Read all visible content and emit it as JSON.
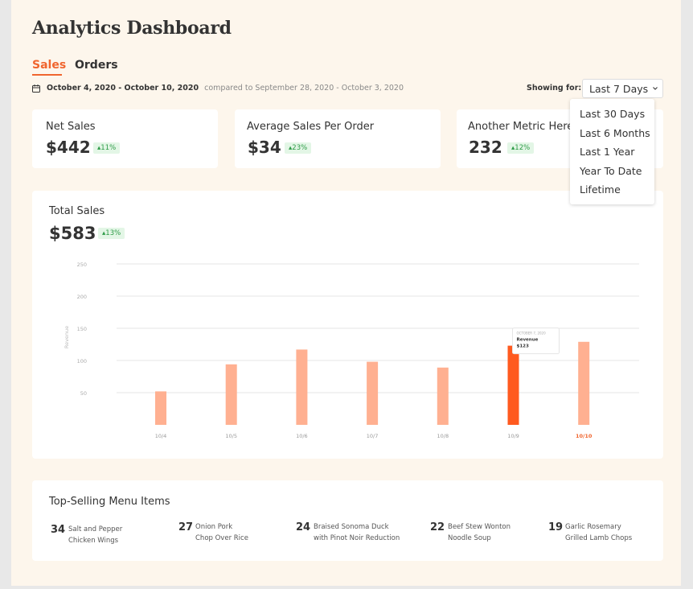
{
  "header": {
    "title": "Analytics Dashboard"
  },
  "tabs": [
    {
      "label": "Sales",
      "active": true
    },
    {
      "label": "Orders",
      "active": false
    }
  ],
  "date_range": {
    "icon": "calendar-icon",
    "range": "October 4, 2020 - October 10, 2020",
    "compare": "compared to September 28, 2020 - October 3, 2020"
  },
  "period_selector": {
    "label": "Showing for:",
    "selected": "Last 7 Days",
    "options": [
      "Last 30 Days",
      "Last 6 Months",
      "Last 1 Year",
      "Year To Date",
      "Lifetime"
    ]
  },
  "metrics": [
    {
      "label": "Net Sales",
      "value": "$442",
      "change": "11%"
    },
    {
      "label": "Average Sales Per Order",
      "value": "$34",
      "change": "23%"
    },
    {
      "label": "Another Metric Here",
      "value": "232",
      "change": "12%"
    }
  ],
  "total_sales": {
    "title": "Total Sales",
    "value": "$583",
    "change": "13%"
  },
  "chart_data": {
    "type": "bar",
    "ylabel": "Revenue",
    "ylim": [
      0,
      250
    ],
    "yticks": [
      50,
      100,
      150,
      200,
      250
    ],
    "grid": true,
    "categories": [
      "10/4",
      "10/5",
      "10/6",
      "10/7",
      "10/8",
      "10/9",
      "10/10"
    ],
    "values": [
      52,
      94,
      117,
      98,
      89,
      123,
      129
    ],
    "highlight_index": 5,
    "highlight_label_index": 6,
    "tooltip": {
      "date": "OCTOBER 7, 2020",
      "label": "Revenue",
      "value": "$123"
    },
    "colors": {
      "bar": "#ffb091",
      "bar_active": "#ff5a1f",
      "label_active": "#f0652e",
      "grid": "#e6e6e6",
      "axis_text": "#aaa"
    }
  },
  "top_selling": {
    "title": "Top-Selling Menu Items",
    "items": [
      {
        "count": "34",
        "name_line1": "Salt and Pepper",
        "name_line2": "Chicken Wings"
      },
      {
        "count": "27",
        "name_line1": "Onion Pork",
        "name_line2": "Chop Over Rice"
      },
      {
        "count": "24",
        "name_line1": "Braised Sonoma Duck",
        "name_line2": "with Pinot Noir Reduction"
      },
      {
        "count": "22",
        "name_line1": "Beef Stew Wonton",
        "name_line2": "Noodle Soup"
      },
      {
        "count": "19",
        "name_line1": "Garlic Rosemary",
        "name_line2": "Grilled Lamb Chops"
      }
    ]
  },
  "colors": {
    "accent": "#f0652e",
    "background": "#fdf6ec",
    "badge_bg": "#e3f6e6",
    "badge_text": "#2f9c48"
  }
}
